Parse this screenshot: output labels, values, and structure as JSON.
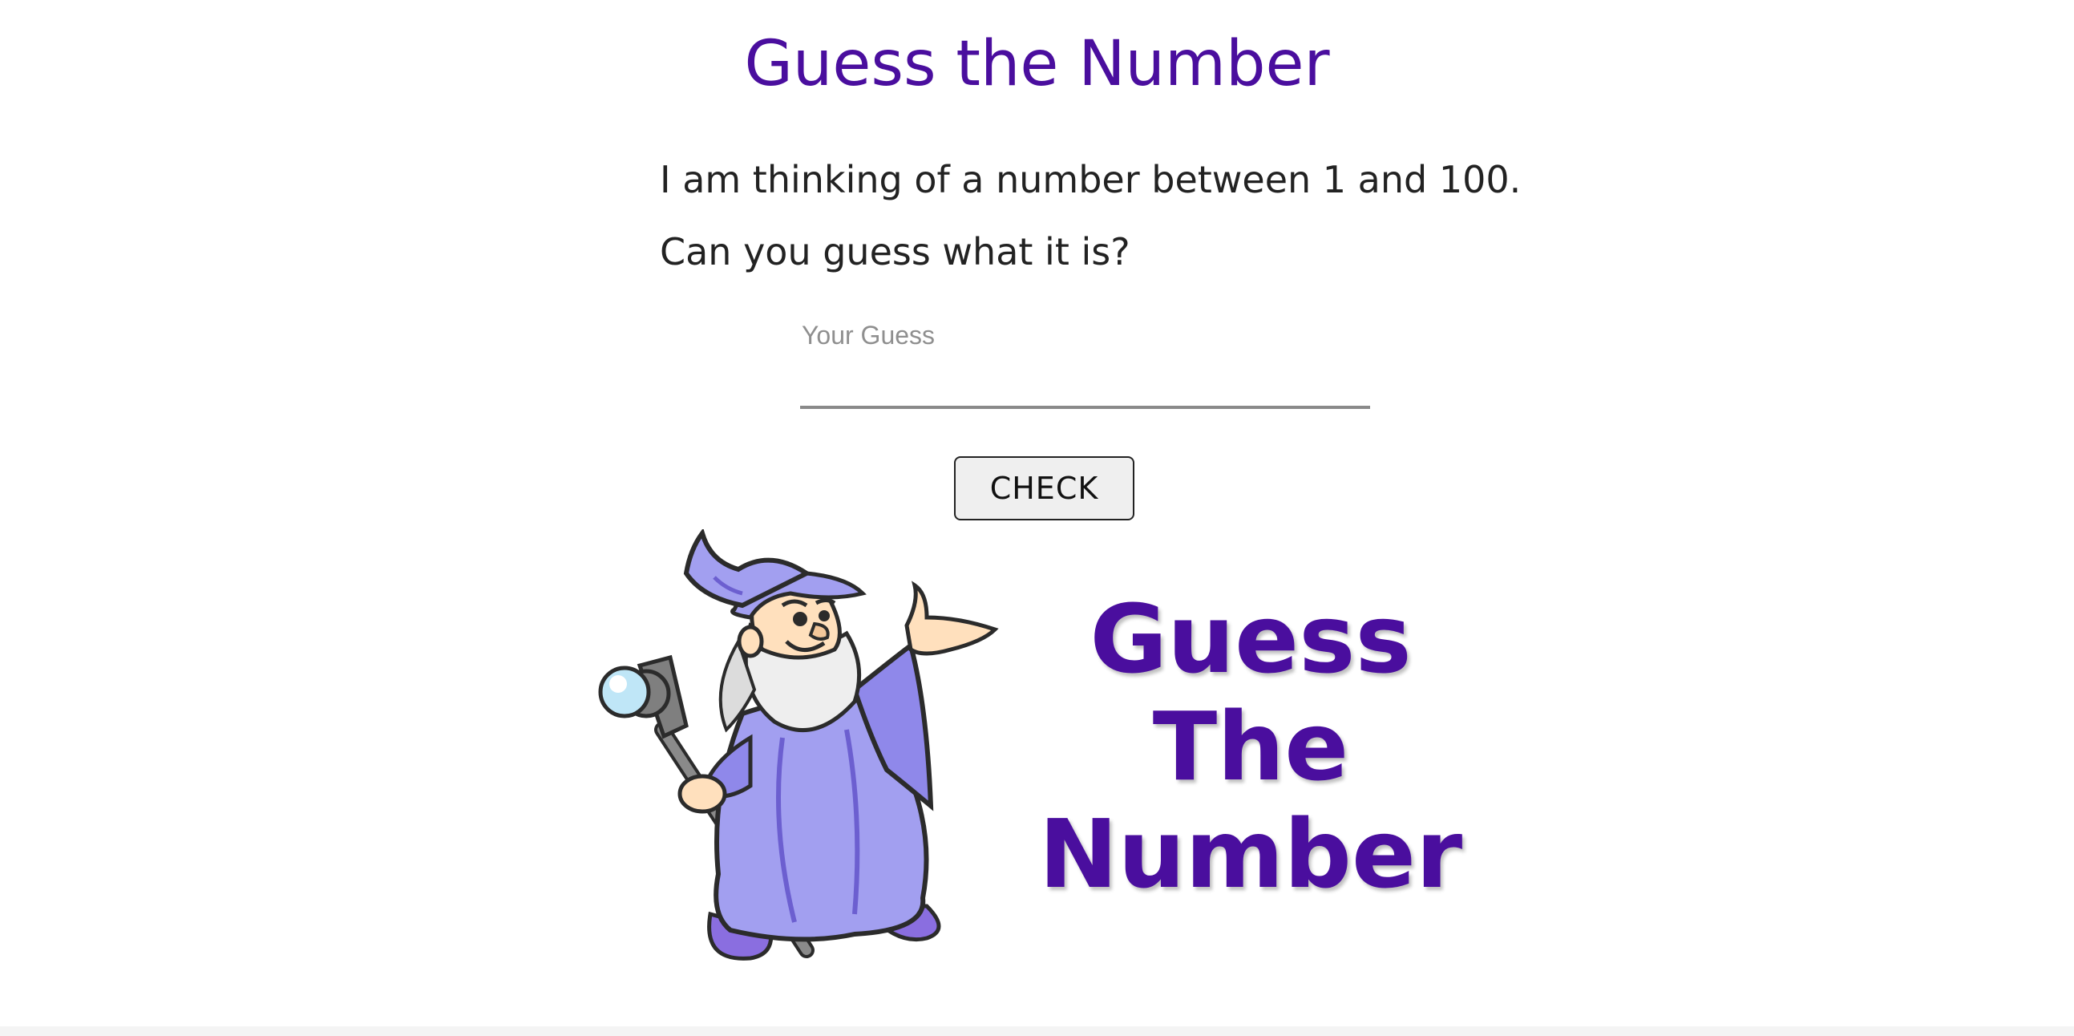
{
  "page": {
    "title": "Guess the Number",
    "intro_line1": "I am thinking of a number between 1 and 100.",
    "intro_line2": "Can you guess what it is?"
  },
  "guess_input": {
    "label": "Your Guess",
    "value": ""
  },
  "check_button": {
    "label": "CHECK"
  },
  "logo": {
    "line1": "Guess",
    "line2": "The",
    "line3": "Number",
    "illustration": "wizard-with-staff"
  },
  "colors": {
    "accent": "#4a0e9e",
    "text": "#222222",
    "wizard_robe": "#a29ff0",
    "wizard_robe_dark": "#6c5fd0"
  }
}
